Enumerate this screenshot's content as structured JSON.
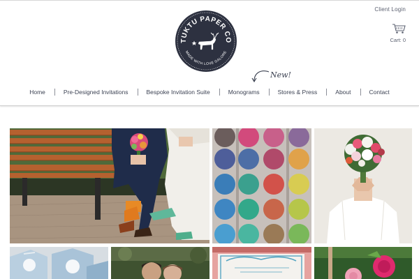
{
  "header": {
    "client_login": "Client Login",
    "cart_label": "Cart: 0",
    "new_badge": "New!",
    "logo": {
      "name_text": "TUKTU PAPER CO",
      "tagline_text": "MADE WITH LOVE GALORE"
    }
  },
  "nav": {
    "items": [
      {
        "label": "Home"
      },
      {
        "label": "Pre-Designed Invitations"
      },
      {
        "label": "Bespoke Invitation Suite"
      },
      {
        "label": "Monograms"
      },
      {
        "label": "Stores & Press"
      },
      {
        "label": "About"
      },
      {
        "label": "Contact"
      }
    ]
  },
  "gallery": {
    "tiles": [
      {
        "subject": "couple-on-bench"
      },
      {
        "subject": "watercolor-paint-palette"
      },
      {
        "subject": "woman-holding-bouquet"
      },
      {
        "subject": "blue-favor-boxes"
      },
      {
        "subject": "couple-portrait"
      },
      {
        "subject": "invitation-card"
      },
      {
        "subject": "pink-roses"
      }
    ]
  },
  "colors": {
    "logo_dark": "#2d3140",
    "nav_text": "#3d4354",
    "page_background": "#ffffff"
  },
  "icons": [
    "cart-icon",
    "stag-icon",
    "curved-arrow-icon",
    "star-icon"
  ]
}
